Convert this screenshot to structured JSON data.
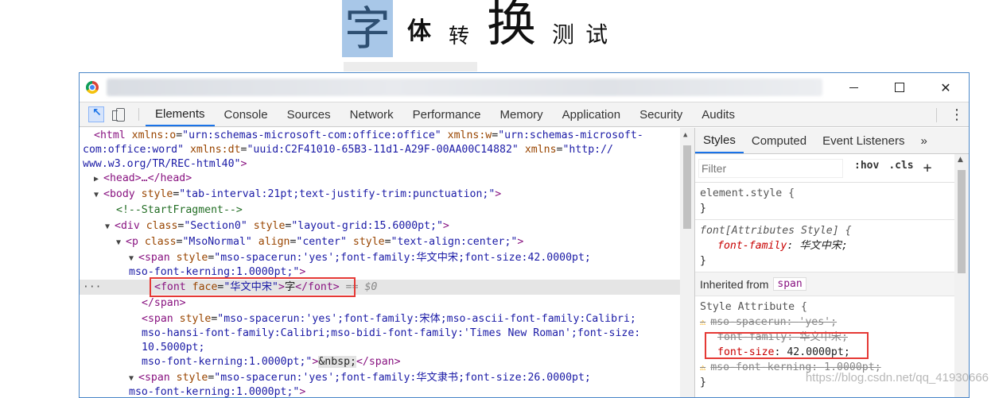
{
  "page_heading": {
    "chars": [
      "字",
      "体",
      "转",
      "换",
      "测",
      "试"
    ]
  },
  "devtools": {
    "tabs": [
      "Elements",
      "Console",
      "Sources",
      "Network",
      "Performance",
      "Memory",
      "Application",
      "Security",
      "Audits"
    ],
    "active_tab": "Elements",
    "window_controls": {
      "close": "✕"
    }
  },
  "elements_code": {
    "l1": {
      "tag_open": "<html ",
      "a1": "xmlns:o",
      "v1": "\"urn:schemas-microsoft-com:office:office\"",
      "a2": " xmlns:w",
      "v2": "\"urn:schemas-microsoft-"
    },
    "l2": {
      "v2b": "com:office:word\"",
      "a3": " xmlns:dt",
      "v3": "\"uuid:C2F41010-65B3-11d1-A29F-00AA00C14882\"",
      "a4": " xmlns",
      "v4": "\"http://"
    },
    "l3": {
      "v4b": "www.w3.org/TR/REC-html40\"",
      "close": ">"
    },
    "l4": {
      "text": "<head>…</head>"
    },
    "l5": {
      "tag": "<body ",
      "a": "style",
      "v": "\"tab-interval:21pt;text-justify-trim:punctuation;\"",
      "close": ">"
    },
    "l6": {
      "comment": "<!--StartFragment-->"
    },
    "l7": {
      "tag": "<div ",
      "a1": "class",
      "v1": "\"Section0\"",
      "a2": " style",
      "v2": "\"layout-grid:15.6000pt;\"",
      "close": ">"
    },
    "l8": {
      "tag": "<p ",
      "a1": "class",
      "v1": "\"MsoNormal\"",
      "a2": " align",
      "v2": "\"center\"",
      "a3": " style",
      "v3": "\"text-align:center;\"",
      "close": ">"
    },
    "l9": {
      "tag": "<span ",
      "a": "style",
      "v": "\"mso-spacerun:'yes';font-family:华文中宋;font-size:42.0000pt;"
    },
    "l10": {
      "v": "mso-font-kerning:1.0000pt;\"",
      "close": ">"
    },
    "l11": {
      "tag": "<font ",
      "a": "face",
      "v": "\"华文中宋\"",
      "mid": ">",
      "text": "字",
      "end": "</font>",
      "ref": " == $0"
    },
    "l12": {
      "text": "</span>"
    },
    "l13": {
      "tag": "<span ",
      "a": "style",
      "v": "\"mso-spacerun:'yes';font-family:宋体;mso-ascii-font-family:Calibri;"
    },
    "l14": {
      "v": "mso-hansi-font-family:Calibri;mso-bidi-font-family:'Times New Roman';font-size:"
    },
    "l15": {
      "v": "10.5000pt;"
    },
    "l16": {
      "v": "mso-font-kerning:1.0000pt;\"",
      "close": ">",
      "text": "&nbsp;",
      "end": "</span>"
    },
    "l17": {
      "tag": "<span ",
      "a": "style",
      "v": "\"mso-spacerun:'yes';font-family:华文隶书;font-size:26.0000pt;"
    },
    "l18": {
      "v": "mso-font-kerning:1.0000pt;\"",
      "close": ">"
    }
  },
  "styles": {
    "subtabs": [
      "Styles",
      "Computed",
      "Event Listeners",
      "»"
    ],
    "filter_placeholder": "Filter",
    "hov": ":hov",
    "cls": ".cls",
    "plus": "+",
    "element_style": "element.style {",
    "close_brace": "}",
    "attr_selector": "font[Attributes Style] {",
    "attr_prop": "font-family",
    "attr_val": "华文中宋;",
    "inherited_label": "Inherited from",
    "inherited_tag": "span",
    "style_attr": "Style Attribute {",
    "rules": [
      {
        "prop": "mso-spacerun",
        "val": "'yes';",
        "struck": true,
        "warn": true
      },
      {
        "prop": "font-family",
        "val": "华文中宋;",
        "struck": true,
        "warn": false
      },
      {
        "prop": "font-size",
        "val": "42.0000pt;",
        "struck": false,
        "warn": false
      },
      {
        "prop": "mso-font-kerning",
        "val": "1.0000pt;",
        "struck": true,
        "warn": true
      }
    ]
  },
  "watermark": "https://blog.csdn.net/qq_41930666"
}
